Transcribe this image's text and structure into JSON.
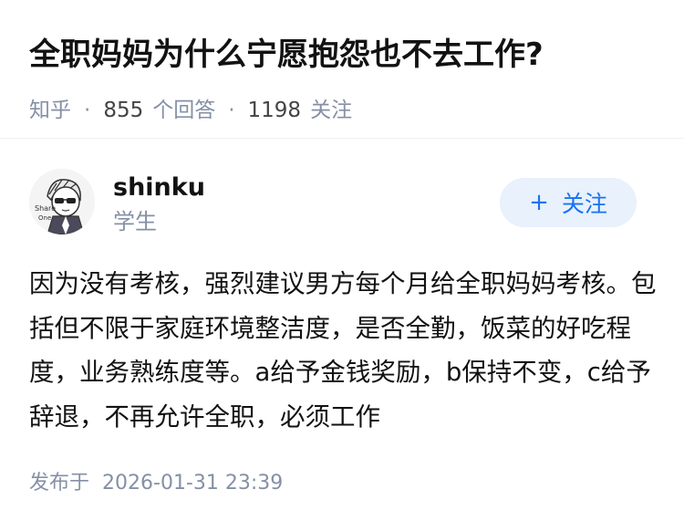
{
  "question": {
    "title": "全职妈妈为什么宁愿抱怨也不去工作?"
  },
  "meta": {
    "source": "知乎",
    "answers_count": "855",
    "answers_label": "个回答",
    "followers_count": "1198",
    "followers_label": "关注"
  },
  "author": {
    "name": "shinku",
    "role": "学生",
    "avatar_icon": "cartoon-avatar-icon",
    "follow_plus": "+",
    "follow_label": "关注"
  },
  "answer": {
    "text": "因为没有考核，强烈建议男方每个月给全职妈妈考核。包括但不限于家庭环境整洁度，是否全勤，饭菜的好吃程度，业务熟练度等。a给予金钱奖励，b保持不变，c给予辞退，不再允许全职，必须工作",
    "published_label": "发布于",
    "published_time": "2026-01-31 23:39"
  },
  "colors": {
    "accent": "#1772f6",
    "follow_bg": "#e8f1fc",
    "meta_gray": "#8590a6"
  }
}
